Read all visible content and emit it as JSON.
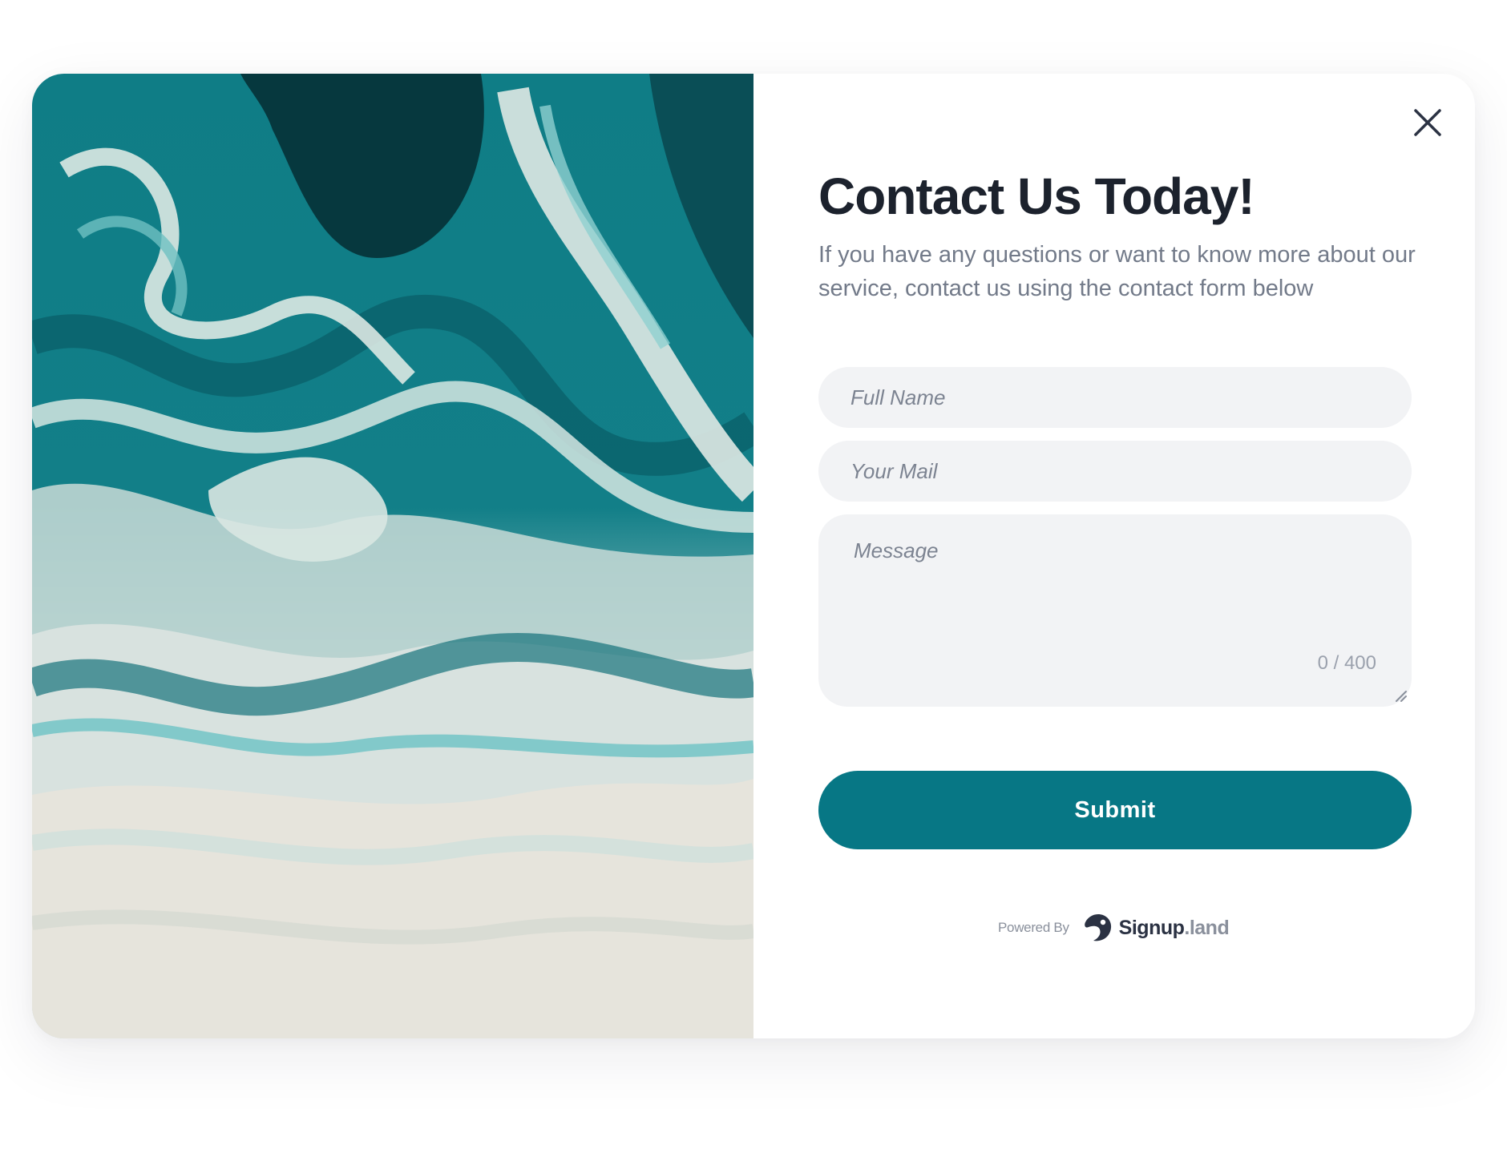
{
  "modal": {
    "title": "Contact Us Today!",
    "subtitle": "If you have any questions or want to know more about our service,  contact us using the contact form below",
    "close_icon": "close-icon"
  },
  "form": {
    "full_name": {
      "value": "",
      "placeholder": "Full Name"
    },
    "email": {
      "value": "",
      "placeholder": "Your Mail"
    },
    "message": {
      "value": "",
      "placeholder": "Message",
      "counter": "0 / 400"
    },
    "submit_label": "Submit"
  },
  "footer": {
    "powered_label": "Powered By",
    "brand_name": "Signup",
    "brand_tld": ".land",
    "logo_icon": "signup-land-logo-icon"
  },
  "colors": {
    "accent": "#077785",
    "title": "#1c222d",
    "subtitle": "#727a89",
    "field_background": "#f2f3f5",
    "placeholder": "#7c8391"
  }
}
